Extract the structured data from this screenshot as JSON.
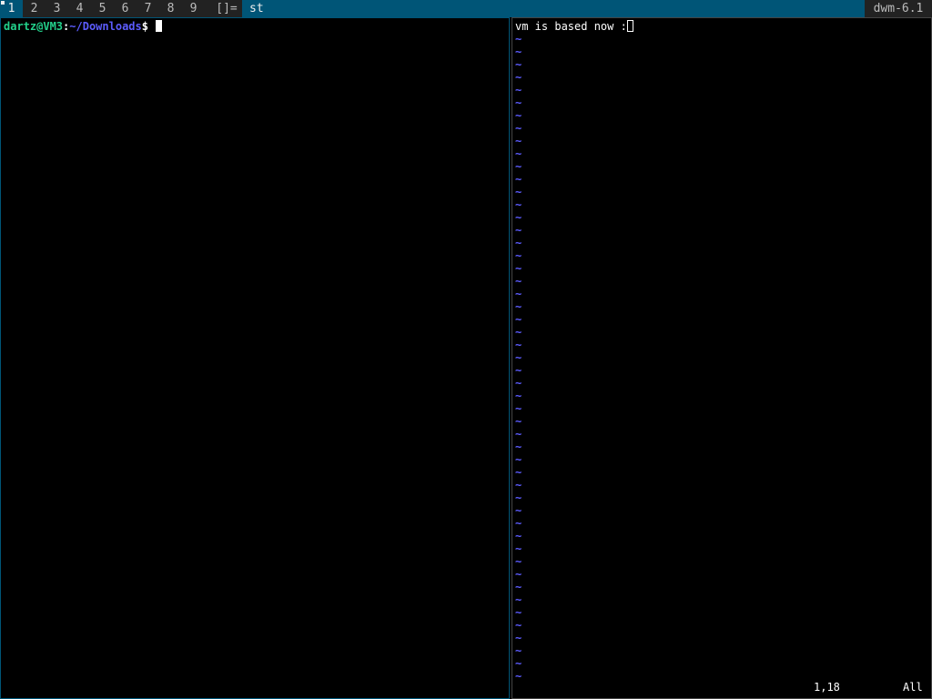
{
  "bar": {
    "tags": [
      "1",
      "2",
      "3",
      "4",
      "5",
      "6",
      "7",
      "8",
      "9"
    ],
    "selected_tag": "1",
    "layout_symbol": "[]=",
    "window_title": "st",
    "status": "dwm-6.1"
  },
  "terminal": {
    "user": "dartz",
    "at": "@",
    "host": "VM3",
    "sep": ":",
    "path": "~/Downloads",
    "dollar": "$ "
  },
  "vim": {
    "text": "vm is based now :",
    "cursor_char": "",
    "tilde": "~",
    "tilde_lines": 51,
    "position": "1,18",
    "scroll": "All"
  },
  "colors": {
    "bar_bg": "#222222",
    "bar_fg": "#bbbbbb",
    "selected_bg": "#005577",
    "selected_fg": "#eeeeee",
    "prompt_green": "#23d18b",
    "path_blue": "#5c5cff"
  }
}
